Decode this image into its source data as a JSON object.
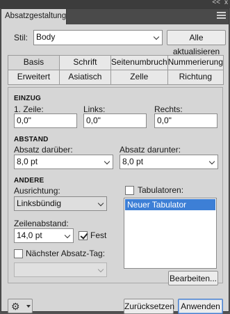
{
  "window": {
    "collapse_glyph": "<<",
    "close_glyph": "x"
  },
  "tab": {
    "title": "Absatzgestaltung"
  },
  "style_row": {
    "label": "Stil:",
    "value": "Body",
    "update_all_label": "Alle aktualisieren"
  },
  "categories": {
    "items": [
      "Basis",
      "Schrift",
      "Seitenumbruch",
      "Nummerierung",
      "Erweitert",
      "Asiatisch",
      "Zelle",
      "Richtung"
    ],
    "selected": "Basis"
  },
  "einzug": {
    "section_label": "EINZUG",
    "first_line_label": "1. Zeile:",
    "first_line_value": "0,0\"",
    "left_label": "Links:",
    "left_value": "0,0\"",
    "right_label": "Rechts:",
    "right_value": "0,0\""
  },
  "abstand": {
    "section_label": "ABSTAND",
    "before_label": "Absatz darüber:",
    "before_value": "8,0 pt",
    "after_label": "Absatz darunter:",
    "after_value": "8,0 pt"
  },
  "andere": {
    "section_label": "ANDERE",
    "alignment_label": "Ausrichtung:",
    "alignment_value": "Linksbündig",
    "leading_label": "Zeilenabstand:",
    "leading_value": "14,0 pt",
    "fixed_label": "Fest",
    "fixed_checked": true,
    "next_tag_label": "Nächster Absatz-Tag:",
    "next_tag_checked": false,
    "next_tag_value": "",
    "tabs_label": "Tabulatoren:",
    "tabs_checked": false,
    "tab_list": [
      "Neuer Tabulator"
    ],
    "edit_label": "Bearbeiten..."
  },
  "footer": {
    "settings_icon": "gear-icon",
    "reset_label": "Zurücksetzen",
    "apply_label": "Anwenden"
  },
  "colors": {
    "panel_bg": "#d6d6d6",
    "chrome_bg": "#535353",
    "selection": "#3d7fd6"
  }
}
